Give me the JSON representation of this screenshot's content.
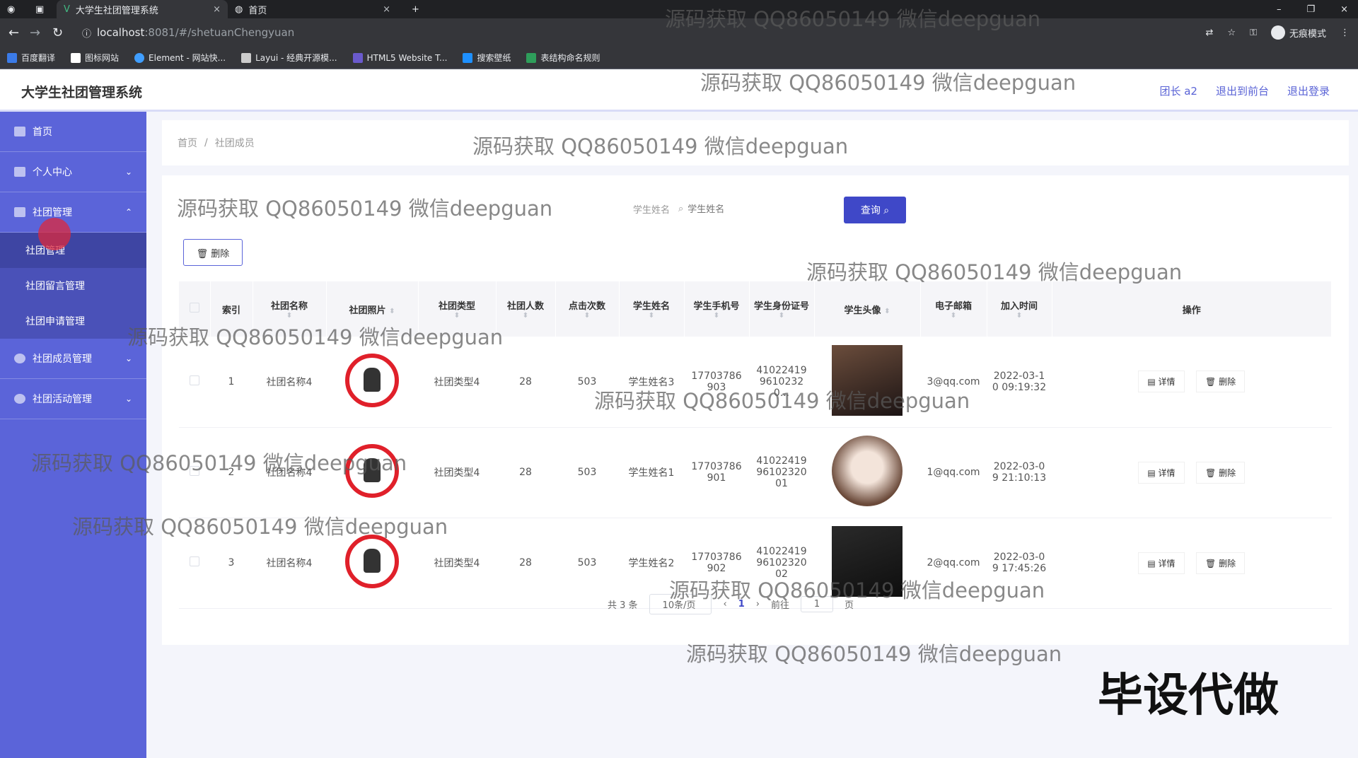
{
  "browser": {
    "tabs": [
      {
        "label": "大学生社团管理系统",
        "close": "×"
      },
      {
        "label": "首页",
        "close": "×"
      }
    ],
    "new_tab": "+",
    "window_controls": [
      "–",
      "❐",
      "×"
    ],
    "url_host": "localhost",
    "url_path": ":8081/#/shetuanChengyuan",
    "incognito_label": "无痕模式",
    "bookmarks": [
      {
        "label": "百度翻译",
        "color": "#3b7be8"
      },
      {
        "label": "图标网站",
        "color": "#ffffff"
      },
      {
        "label": "Element - 网站快...",
        "color": "#409eff"
      },
      {
        "label": "Layui - 经典开源模...",
        "color": "#cccccc"
      },
      {
        "label": "HTML5 Website T...",
        "color": "#6a5acd"
      },
      {
        "label": "搜索壁纸",
        "color": "#1e90ff"
      },
      {
        "label": "表结构命名规则",
        "color": "#2e9e5b"
      }
    ]
  },
  "header": {
    "title": "大学生社团管理系统",
    "links": [
      "团长 a2",
      "退出到前台",
      "退出登录"
    ]
  },
  "sidebar": {
    "items": [
      {
        "label": "首页",
        "chevron": ""
      },
      {
        "label": "个人中心",
        "chevron": "⌄"
      },
      {
        "label": "社团管理",
        "chevron": "⌃"
      }
    ],
    "subitems": [
      "社团管理",
      "社团留言管理",
      "社团申请管理"
    ],
    "items_after": [
      {
        "label": "社团成员管理",
        "chevron": "⌄"
      },
      {
        "label": "社团活动管理",
        "chevron": "⌄"
      }
    ]
  },
  "breadcrumb": {
    "home": "首页",
    "sep": "/",
    "current": "社团成员"
  },
  "search": {
    "student_name_label": "学生姓名",
    "student_name_placeholder": "学生姓名",
    "query_label": "查询 ⌕"
  },
  "toolbar": {
    "delete_label": "🗑 删除"
  },
  "table": {
    "columns": [
      "索引",
      "社团名称",
      "社团照片",
      "社团类型",
      "社团人数",
      "点击次数",
      "学生姓名",
      "学生手机号",
      "学生身份证号",
      "学生头像",
      "电子邮箱",
      "加入时间",
      "操作"
    ],
    "rows": [
      {
        "index": "1",
        "name": "社团名称4",
        "type": "社团类型4",
        "count": "28",
        "clicks": "503",
        "student": "学生姓名3",
        "phone": "17703786903",
        "idcard": "4102241996102320...",
        "email": "3@qq.com",
        "time": "2022-03-10 09:19:32"
      },
      {
        "index": "2",
        "name": "社团名称4",
        "type": "社团类型4",
        "count": "28",
        "clicks": "503",
        "student": "学生姓名1",
        "phone": "17703786901",
        "idcard": "410224199610232001",
        "email": "1@qq.com",
        "time": "2022-03-09 21:10:13"
      },
      {
        "index": "3",
        "name": "社团名称4",
        "type": "社团类型4",
        "count": "28",
        "clicks": "503",
        "student": "学生姓名2",
        "phone": "17703786902",
        "idcard": "410224199610232002",
        "email": "2@qq.com",
        "time": "2022-03-09 17:45:26"
      }
    ],
    "detail_label": "详情",
    "delete_label": "删除"
  },
  "pager": {
    "total": "共 3 条",
    "size": "10条/页",
    "prev": "‹",
    "page": "1",
    "next": "›",
    "goto": "前往",
    "goto_value": "1",
    "page_suffix": "页"
  },
  "watermark": "源码获取 QQ86050149 微信deepguan",
  "promo": "毕设代做"
}
